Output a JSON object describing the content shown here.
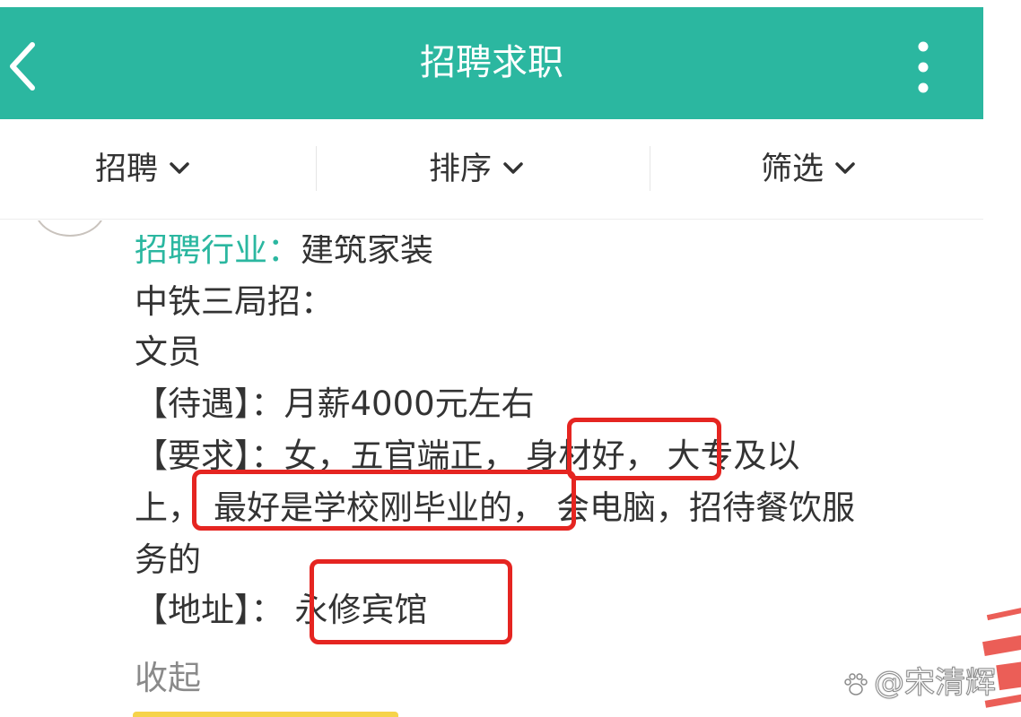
{
  "header": {
    "title": "招聘求职",
    "back_icon": "chevron-left-icon",
    "more_icon": "more-vertical-icon",
    "bar_color": "#2bb7a0"
  },
  "filters": [
    {
      "label": "招聘"
    },
    {
      "label": "排序"
    },
    {
      "label": "筛选"
    }
  ],
  "post": {
    "industry_label": "招聘行业：",
    "industry_value": "建筑家装",
    "company": "中铁三局招：",
    "position": "文员",
    "salary_label": "【待遇】：",
    "salary_value": "月薪4000元左右",
    "requirement_label": "【要求】：",
    "requirement_part1": "女，五官端正，",
    "requirement_highlight1": "身材好，",
    "requirement_part2": "大专及以",
    "requirement_part3": "上，",
    "requirement_highlight2": "最好是学校刚毕业的，",
    "requirement_part4": "会电脑，招待餐饮服",
    "requirement_part5": "务的",
    "address_label": "【地址】：",
    "address_value": "永修宾馆",
    "collapse_label": "收起"
  },
  "highlight_color": "#e52521",
  "watermark": {
    "text": "@宋清辉",
    "icon": "paw-icon"
  }
}
